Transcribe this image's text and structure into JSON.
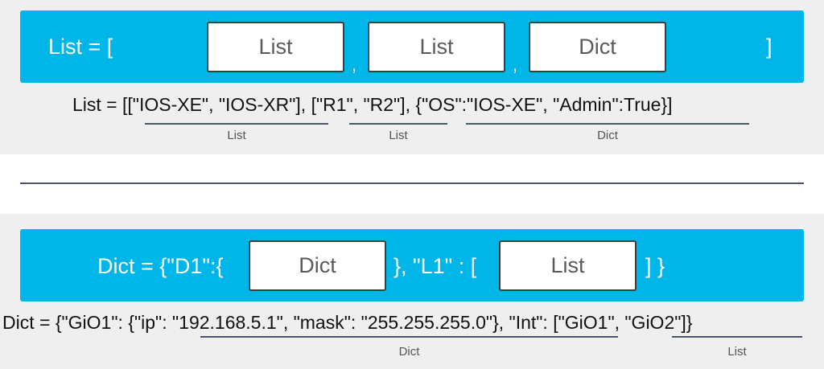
{
  "top": {
    "bar_prefix": "List = [",
    "boxes": [
      "List",
      "List",
      "Dict"
    ],
    "comma": ",",
    "bar_suffix": "]",
    "code": "List = [[\"IOS-XE\", \"IOS-XR\"], [\"R1\", \"R2\"], {\"OS\":\"IOS-XE\", \"Admin\":True}]",
    "labels": [
      "List",
      "List",
      "Dict"
    ]
  },
  "bottom": {
    "bar_prefix": "Dict = {\"D1\":{",
    "box1": "Dict",
    "bar_middle": "}, \"L1\" : [",
    "box2": "List",
    "bar_suffix": "] }",
    "code": "Dict = {\"GiO1\": {\"ip\": \"192.168.5.1\", \"mask\": \"255.255.255.0\"}, \"Int\": [\"GiO1\", \"GiO2\"]}",
    "labels": [
      "Dict",
      "List"
    ]
  },
  "colors": {
    "bar": "#00b5e8",
    "panel": "#efefef",
    "underline": "#4a5568"
  }
}
